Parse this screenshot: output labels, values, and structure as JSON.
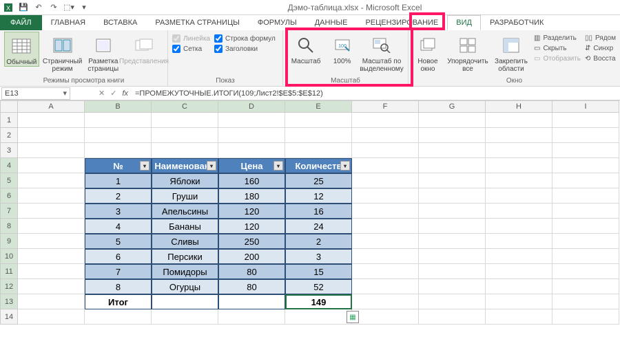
{
  "title": "Дэмо-таблица.xlsx - Microsoft Excel",
  "tabs": {
    "file": "ФАЙЛ",
    "home": "ГЛАВНАЯ",
    "insert": "ВСТАВКА",
    "layout": "РАЗМЕТКА СТРАНИЦЫ",
    "formulas": "ФОРМУЛЫ",
    "data": "ДАННЫЕ",
    "review": "РЕЦЕНЗИРОВАНИЕ",
    "view": "ВИД",
    "dev": "РАЗРАБОТЧИК"
  },
  "ribbon": {
    "views": {
      "normal": "Обычный",
      "pagebreak": "Страничный режим",
      "pagelayout": "Разметка страницы",
      "custom": "Представления",
      "group": "Режимы просмотра книги"
    },
    "show": {
      "ruler": "Линейка",
      "formula_bar": "Строка формул",
      "grid": "Сетка",
      "headings": "Заголовки",
      "group": "Показ"
    },
    "zoom": {
      "zoom": "Масштаб",
      "p100": "100%",
      "selection": "Масштаб по выделенному",
      "group": "Масштаб"
    },
    "window": {
      "new": "Новое окно",
      "arrange": "Упорядочить все",
      "freeze": "Закрепить области",
      "split": "Разделить",
      "hide": "Скрыть",
      "unhide": "Отобразить",
      "side": "Рядом",
      "sync": "Синхр",
      "reset": "Восста",
      "group": "Окно"
    }
  },
  "namebox": "E13",
  "formula": "=ПРОМЕЖУТОЧНЫЕ.ИТОГИ(109;Лист2!$E$5:$E$12)",
  "columns": [
    "A",
    "B",
    "C",
    "D",
    "E",
    "F",
    "G",
    "H",
    "I"
  ],
  "rowcount": 14,
  "table": {
    "headers": [
      "№",
      "Наименовани",
      "Цена",
      "Количеств"
    ],
    "rows": [
      [
        "1",
        "Яблоки",
        "160",
        "25"
      ],
      [
        "2",
        "Груши",
        "180",
        "12"
      ],
      [
        "3",
        "Апельсины",
        "120",
        "16"
      ],
      [
        "4",
        "Бананы",
        "120",
        "24"
      ],
      [
        "5",
        "Сливы",
        "250",
        "2"
      ],
      [
        "6",
        "Персики",
        "200",
        "3"
      ],
      [
        "7",
        "Помидоры",
        "80",
        "15"
      ],
      [
        "8",
        "Огурцы",
        "80",
        "52"
      ]
    ],
    "total_label": "Итог",
    "total_value": "149"
  }
}
